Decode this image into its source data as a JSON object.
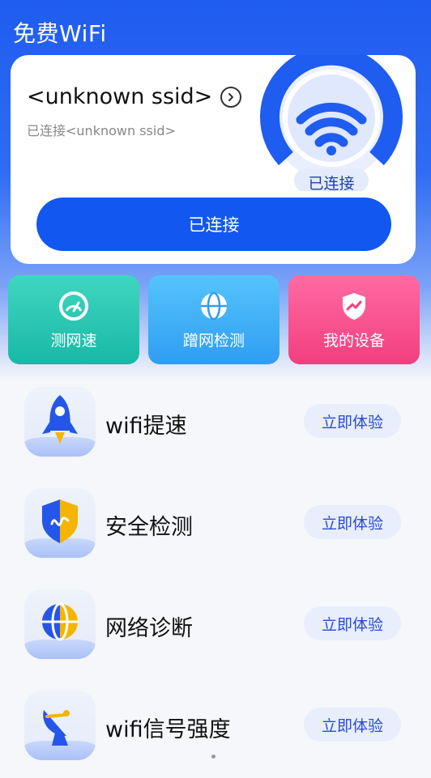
{
  "app": {
    "title": "免费WiFi"
  },
  "connection": {
    "ssid": "<unknown ssid>",
    "status_line": "已连接<unknown ssid>",
    "gauge_label": "已连接",
    "button_label": "已连接"
  },
  "tiles": [
    {
      "label": "测网速",
      "icon": "speedometer-icon"
    },
    {
      "label": "蹭网检测",
      "icon": "globe-icon"
    },
    {
      "label": "我的设备",
      "icon": "shield-icon"
    }
  ],
  "features": [
    {
      "title": "wifi提速",
      "action": "立即体验",
      "icon": "rocket-icon"
    },
    {
      "title": "安全检测",
      "action": "立即体验",
      "icon": "shield-icon"
    },
    {
      "title": "网络诊断",
      "action": "立即体验",
      "icon": "globe-icon"
    },
    {
      "title": "wifi信号强度",
      "action": "立即体验",
      "icon": "satellite-dish-icon"
    }
  ],
  "colors": {
    "primary": "#1257f0",
    "tile_speed": "#18b9a6",
    "tile_check": "#2f9df2",
    "tile_device": "#f23f7f",
    "action_text": "#2a4bd8"
  }
}
